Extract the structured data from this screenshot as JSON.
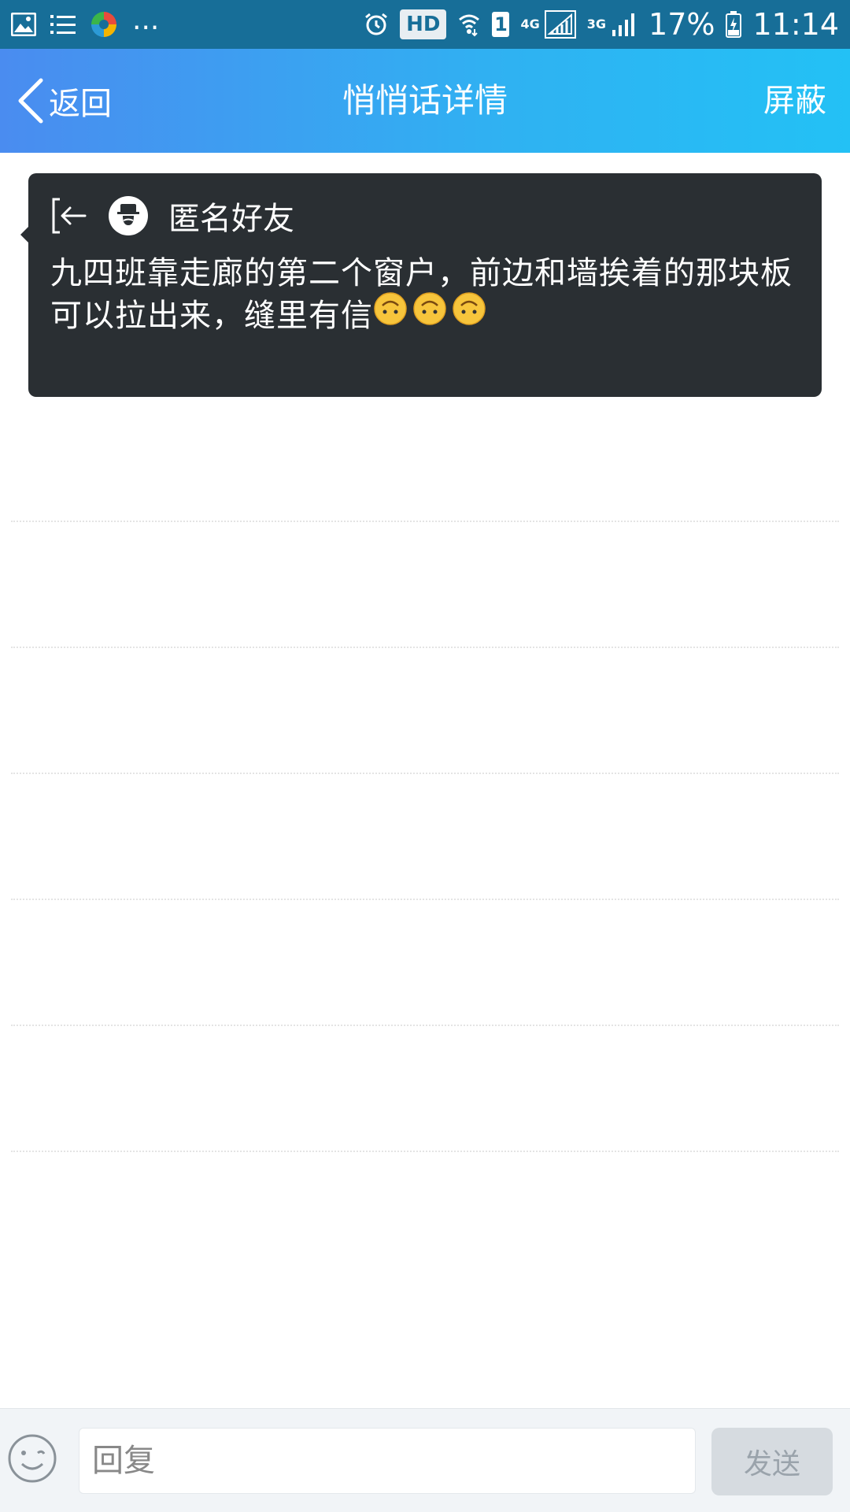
{
  "status_bar": {
    "ellipsis": "...",
    "hd": "HD",
    "sim": "1",
    "net_4g": "4G",
    "net_3g": "3G",
    "battery": "17%",
    "time": "11:14",
    "icons": [
      "gallery-icon",
      "list-icon",
      "app-icon",
      "alarm-icon",
      "wifi-icon",
      "signal-icon",
      "battery-charging-icon"
    ]
  },
  "nav": {
    "back_label": "返回",
    "title": "悄悄话详情",
    "block_label": "屏蔽"
  },
  "message": {
    "sender": "匿名好友",
    "text": "九四班靠走廊的第二个窗户，前边和墙挨着的那块板可以拉出来，缝里有信",
    "emoji_count": 3,
    "emoji_name": "upside-down-face"
  },
  "reply": {
    "placeholder": "回复",
    "send_label": "发送"
  },
  "colors": {
    "status_bar": "#176e98",
    "nav_gradient_start": "#4a8cf0",
    "nav_gradient_end": "#23c1f5",
    "card_bg": "#2a2f33",
    "send_disabled_bg": "#d6dbe0"
  }
}
